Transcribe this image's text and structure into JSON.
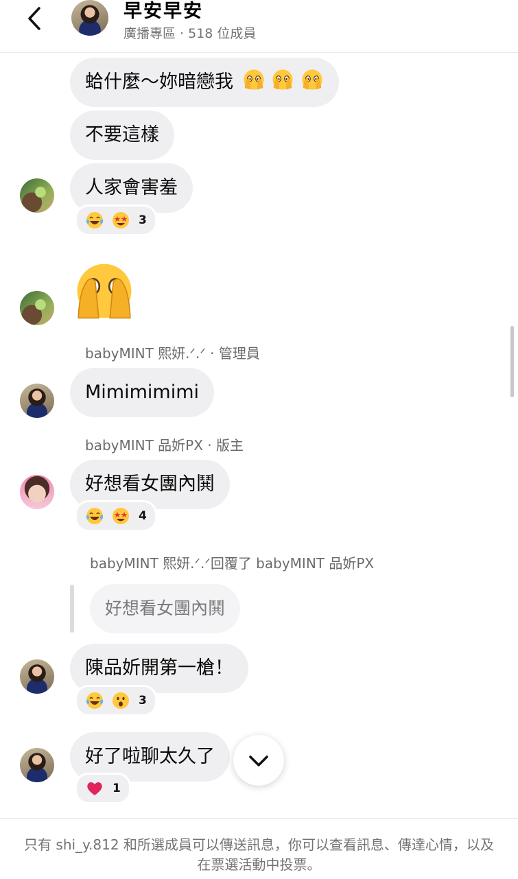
{
  "header": {
    "title": "早安早安",
    "subtitle": "廣播專區 · 518 位成員"
  },
  "messages": [
    {
      "text": "蛤什麼～妳暗戀我"
    },
    {
      "text": "不要這樣"
    },
    {
      "text": "人家會害羞"
    },
    {
      "text": "Mimimimimi"
    },
    {
      "text": "好想看女團內鬨"
    },
    {
      "text": "陳品妡開第一槍！"
    },
    {
      "text": "好了啦聊太久了"
    }
  ],
  "reactions": [
    {
      "emojis": [
        "face-with-tears-of-joy",
        "star-struck"
      ],
      "count": "3"
    },
    {
      "emojis": [
        "face-with-tears-of-joy",
        "star-struck"
      ],
      "count": "4"
    },
    {
      "emojis": [
        "face-with-tears-of-joy",
        "astonished-face"
      ],
      "count": "3"
    },
    {
      "emojis": [
        "red-heart"
      ],
      "count": "1"
    }
  ],
  "senders": {
    "s1": "babyMINT 熙妍.ᐟ.ᐟ · 管理員",
    "s2": "babyMINT 品妡PX · 版主"
  },
  "reply": {
    "header": "babyMINT 熙妍.ᐟ.ᐟ回覆了 babyMINT 品妡PX",
    "quoted": "好想看女團內鬨"
  },
  "footer": {
    "text": "只有 shi_y.812 和所選成員可以傳送訊息，你可以查看訊息、傳達心情，以及在票選活動中投票。"
  },
  "colors": {
    "bubble": "#efeff1",
    "secondary_text": "#737373",
    "heart": "#e0245e"
  }
}
